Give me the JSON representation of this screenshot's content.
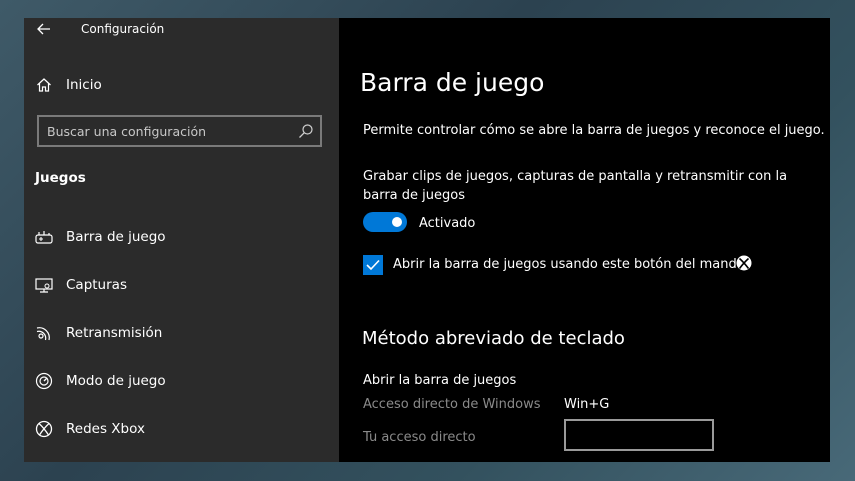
{
  "window": {
    "title": "Configuración"
  },
  "sidebar": {
    "home_label": "Inicio",
    "search_placeholder": "Buscar una configuración",
    "section_title": "Juegos",
    "items": [
      {
        "label": "Barra de juego",
        "icon": "game-bar-icon"
      },
      {
        "label": "Capturas",
        "icon": "captures-icon"
      },
      {
        "label": "Retransmisión",
        "icon": "broadcast-icon"
      },
      {
        "label": "Modo de juego",
        "icon": "game-mode-icon"
      },
      {
        "label": "Redes Xbox",
        "icon": "xbox-icon"
      }
    ]
  },
  "main": {
    "title": "Barra de juego",
    "description": "Permite controlar cómo se abre la barra de juegos y reconoce el juego.",
    "record_label": "Grabar clips de juegos, capturas de pantalla y retransmitir con la barra de juegos",
    "toggle_state": "Activado",
    "checkbox_label": "Abrir la barra de juegos usando este botón del mando:",
    "shortcuts": {
      "title": "Método abreviado de teclado",
      "subtitle": "Abrir la barra de juegos",
      "windows_label": "Acceso directo de Windows",
      "windows_value": "Win+G",
      "custom_label": "Tu acceso directo",
      "custom_value": ""
    }
  },
  "colors": {
    "accent": "#0078d7",
    "sidebar_bg": "#2b2b2b",
    "content_bg": "#000000"
  }
}
